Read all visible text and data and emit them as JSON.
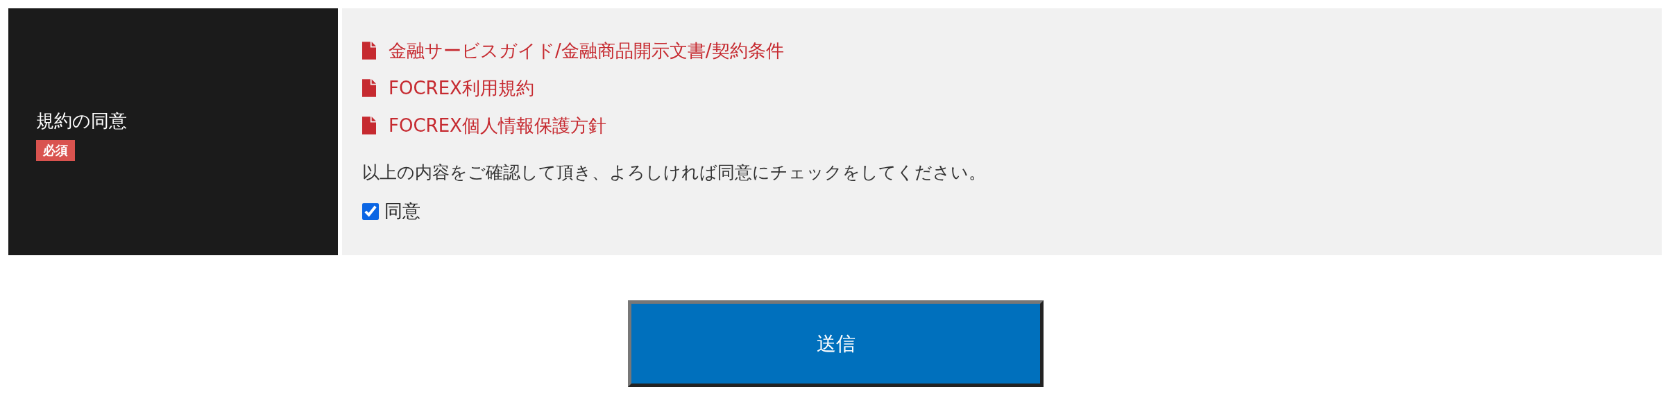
{
  "agreement": {
    "label": "規約の同意",
    "required_badge": "必須",
    "links": [
      {
        "text": "金融サービスガイド/金融商品開示文書/契約条件"
      },
      {
        "text": "FOCREX利用規約"
      },
      {
        "text": "FOCREX個人情報保護方針"
      }
    ],
    "instruction": "以上の内容をご確認して頂き、よろしければ同意にチェックをしてください。",
    "checkbox": {
      "label": "同意",
      "checked": true
    }
  },
  "submit_button": "送信"
}
